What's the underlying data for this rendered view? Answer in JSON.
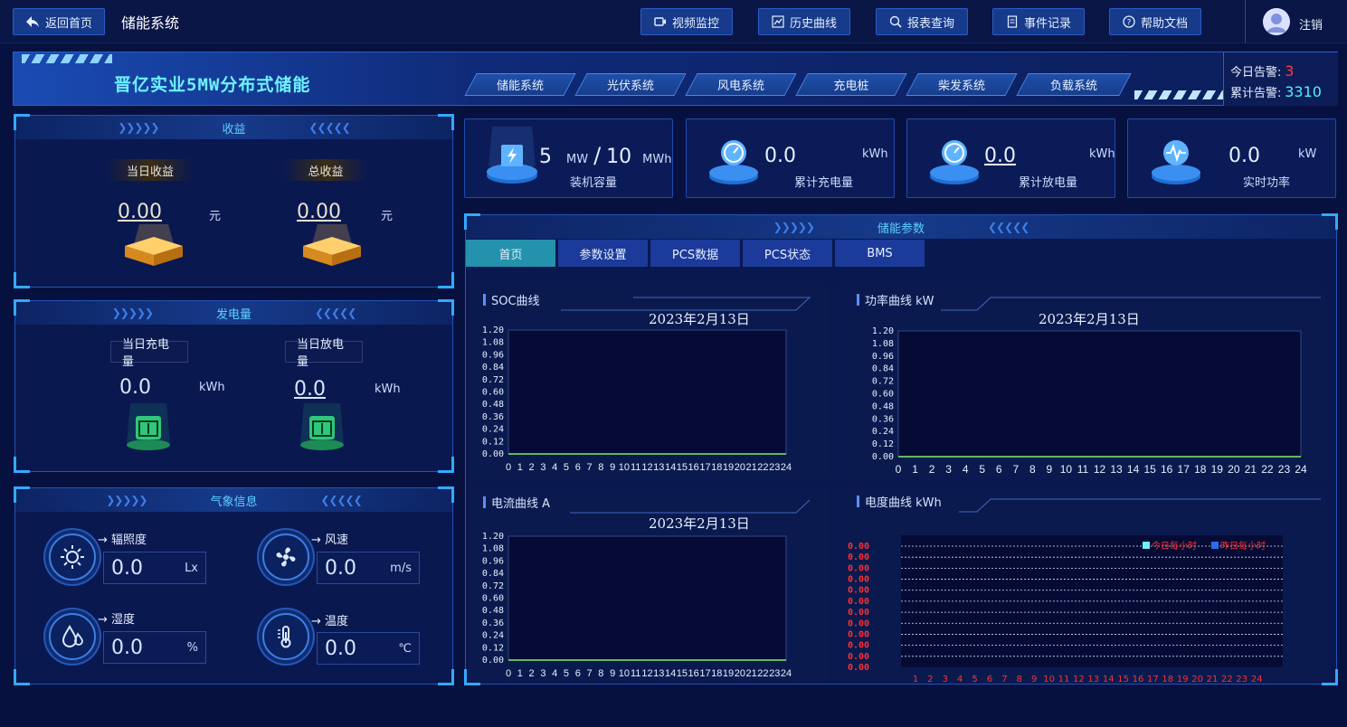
{
  "topbar": {
    "back_label": "返回首页",
    "app_title": "储能系统",
    "nav": [
      "视频监控",
      "历史曲线",
      "报表查询",
      "事件记录",
      "帮助文档"
    ],
    "logout": "注销"
  },
  "banner": {
    "title": "晋亿实业5MW分布式储能",
    "systems": [
      "储能系统",
      "光伏系统",
      "风电系统",
      "充电桩",
      "柴发系统",
      "负载系统"
    ],
    "today_alarm_label": "今日告警:",
    "today_alarm_value": "3",
    "total_alarm_label": "累计告警:",
    "total_alarm_value": "3310"
  },
  "income": {
    "title": "收益",
    "today_label": "当日收益",
    "today_value": "0.00",
    "today_unit": "元",
    "total_label": "总收益",
    "total_value": "0.00",
    "total_unit": "元"
  },
  "energy": {
    "title": "发电量",
    "charge_label": "当日充电量",
    "charge_value": "0.0",
    "charge_unit": "kWh",
    "discharge_label": "当日放电量",
    "discharge_value": "0.0",
    "discharge_unit": "kWh"
  },
  "weather": {
    "title": "气象信息",
    "items": [
      {
        "label": "辐照度",
        "value": "0.0",
        "unit": "Lx",
        "icon": "sun-icon"
      },
      {
        "label": "风速",
        "value": "0.0",
        "unit": "m/s",
        "icon": "fan-icon"
      },
      {
        "label": "湿度",
        "value": "0.0",
        "unit": "%",
        "icon": "droplet-icon"
      },
      {
        "label": "温度",
        "value": "0.0",
        "unit": "℃",
        "icon": "thermometer-icon"
      }
    ]
  },
  "stats": [
    {
      "value_a": "5",
      "unit_a": "MW",
      "sep": "/",
      "value_b": "10",
      "unit_b": "MWh",
      "label": "装机容量",
      "icon": "battery-icon"
    },
    {
      "value": "0.0",
      "unit": "kWh",
      "label": "累计充电量",
      "icon": "gauge-icon"
    },
    {
      "value": "0.0",
      "unit": "kWh",
      "label": "累计放电量",
      "icon": "gauge-icon"
    },
    {
      "value": "0.0",
      "unit": "kW",
      "label": "实时功率",
      "icon": "pulse-icon"
    }
  ],
  "params": {
    "title": "储能参数",
    "tabs": [
      "首页",
      "参数设置",
      "PCS数据",
      "PCS状态",
      "BMS"
    ],
    "active_tab": 0
  },
  "charts": {
    "soc": {
      "title": "SOC曲线",
      "date": "2023年2月13日"
    },
    "power": {
      "title": "功率曲线  kW",
      "date": "2023年2月13日"
    },
    "current": {
      "title": "电流曲线  A",
      "date": "2023年2月13日"
    },
    "kwh": {
      "title": "电度曲线  kWh",
      "legend_today": "今日每小时",
      "legend_yesterday": "昨日每小时"
    }
  },
  "chart_data": [
    {
      "type": "line",
      "title": "SOC曲线",
      "subtitle": "2023年2月13日",
      "x": [
        0,
        1,
        2,
        3,
        4,
        5,
        6,
        7,
        8,
        9,
        10,
        11,
        12,
        13,
        14,
        15,
        16,
        17,
        18,
        19,
        20,
        21,
        22,
        23,
        24
      ],
      "y_ticks": [
        "1.20",
        "1.08",
        "0.96",
        "0.84",
        "0.72",
        "0.60",
        "0.48",
        "0.36",
        "0.24",
        "0.12",
        "0.00"
      ],
      "ylim": [
        0,
        1.2
      ],
      "series": [
        {
          "values": [
            0,
            0,
            0,
            0,
            0,
            0,
            0,
            0,
            0,
            0,
            0,
            0,
            0,
            0,
            0,
            0,
            0,
            0,
            0,
            0,
            0,
            0,
            0,
            0,
            0
          ]
        }
      ]
    },
    {
      "type": "line",
      "title": "功率曲线  kW",
      "subtitle": "2023年2月13日",
      "x": [
        0,
        1,
        2,
        3,
        4,
        5,
        6,
        7,
        8,
        9,
        10,
        11,
        12,
        13,
        14,
        15,
        16,
        17,
        18,
        19,
        20,
        21,
        22,
        23,
        24
      ],
      "y_ticks": [
        "1.20",
        "1.08",
        "0.96",
        "0.84",
        "0.72",
        "0.60",
        "0.48",
        "0.36",
        "0.24",
        "0.12",
        "0.00"
      ],
      "ylim": [
        0,
        1.2
      ],
      "series": [
        {
          "values": [
            0,
            0,
            0,
            0,
            0,
            0,
            0,
            0,
            0,
            0,
            0,
            0,
            0,
            0,
            0,
            0,
            0,
            0,
            0,
            0,
            0,
            0,
            0,
            0,
            0
          ]
        }
      ]
    },
    {
      "type": "line",
      "title": "电流曲线  A",
      "subtitle": "2023年2月13日",
      "x": [
        0,
        1,
        2,
        3,
        4,
        5,
        6,
        7,
        8,
        9,
        10,
        11,
        12,
        13,
        14,
        15,
        16,
        17,
        18,
        19,
        20,
        21,
        22,
        23,
        24
      ],
      "y_ticks": [
        "1.20",
        "1.08",
        "0.96",
        "0.84",
        "0.72",
        "0.60",
        "0.48",
        "0.36",
        "0.24",
        "0.12",
        "0.00"
      ],
      "ylim": [
        0,
        1.2
      ],
      "series": [
        {
          "values": [
            0,
            0,
            0,
            0,
            0,
            0,
            0,
            0,
            0,
            0,
            0,
            0,
            0,
            0,
            0,
            0,
            0,
            0,
            0,
            0,
            0,
            0,
            0,
            0,
            0
          ]
        }
      ]
    },
    {
      "type": "bar",
      "title": "电度曲线  kWh",
      "categories": [
        "1",
        "2",
        "3",
        "4",
        "5",
        "6",
        "7",
        "8",
        "9",
        "10",
        "11",
        "12",
        "13",
        "14",
        "15",
        "16",
        "17",
        "18",
        "19",
        "20",
        "21",
        "22",
        "23",
        "24"
      ],
      "y_ticks": [
        "0.00",
        "0.00",
        "0.00",
        "0.00",
        "0.00",
        "0.00",
        "0.00",
        "0.00",
        "0.00",
        "0.00",
        "0.00",
        "0.00"
      ],
      "series": [
        {
          "name": "今日每小时",
          "values": [
            0,
            0,
            0,
            0,
            0,
            0,
            0,
            0,
            0,
            0,
            0,
            0,
            0,
            0,
            0,
            0,
            0,
            0,
            0,
            0,
            0,
            0,
            0,
            0
          ]
        },
        {
          "name": "昨日每小时",
          "values": [
            0,
            0,
            0,
            0,
            0,
            0,
            0,
            0,
            0,
            0,
            0,
            0,
            0,
            0,
            0,
            0,
            0,
            0,
            0,
            0,
            0,
            0,
            0,
            0
          ]
        }
      ],
      "colors": {
        "today": "#6af2ff",
        "yesterday": "#2d6ef0",
        "ticks": "#ff3030"
      }
    }
  ],
  "colors": {
    "accent": "#2b5cc6",
    "alarm_red": "#ff3b3b",
    "cyan": "#50f1ff",
    "title_cyan": "#6ef2ff"
  }
}
